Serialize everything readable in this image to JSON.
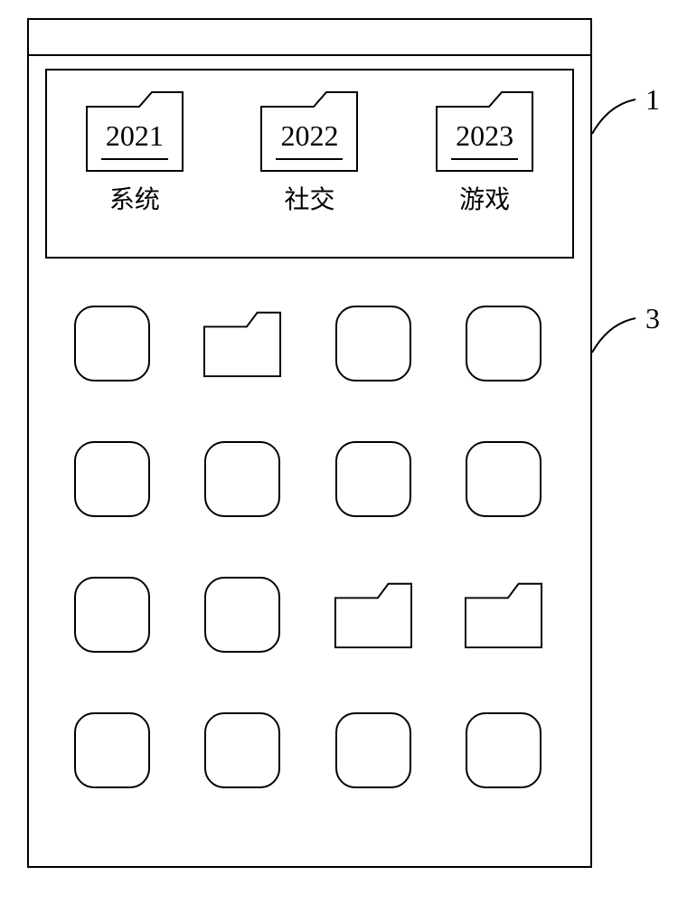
{
  "top_folders": [
    {
      "year": "2021",
      "label": "系统"
    },
    {
      "year": "2022",
      "label": "社交"
    },
    {
      "year": "2023",
      "label": "游戏"
    }
  ],
  "grid": [
    {
      "type": "app"
    },
    {
      "type": "folder"
    },
    {
      "type": "app"
    },
    {
      "type": "app"
    },
    {
      "type": "app"
    },
    {
      "type": "app"
    },
    {
      "type": "app"
    },
    {
      "type": "app"
    },
    {
      "type": "app"
    },
    {
      "type": "app"
    },
    {
      "type": "folder"
    },
    {
      "type": "folder"
    },
    {
      "type": "app"
    },
    {
      "type": "app"
    },
    {
      "type": "app"
    },
    {
      "type": "app"
    }
  ],
  "callouts": {
    "top": "1",
    "middle": "3"
  }
}
